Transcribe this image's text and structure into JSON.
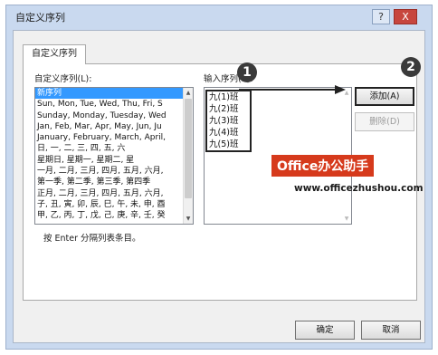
{
  "window": {
    "title": "自定义序列",
    "help_label": "?",
    "close_label": "X"
  },
  "tab": {
    "label": "自定义序列"
  },
  "left_list": {
    "label": "自定义序列(L):",
    "items": [
      "新序列",
      "Sun, Mon, Tue, Wed, Thu, Fri, S",
      "Sunday, Monday, Tuesday, Wed",
      "Jan, Feb, Mar, Apr, May, Jun, Ju",
      "January, February, March, April,",
      "日, 一, 二, 三, 四, 五, 六",
      "星期日, 星期一, 星期二, 星",
      "一月, 二月, 三月, 四月, 五月, 六月,",
      "第一季, 第二季, 第三季, 第四季",
      "正月, 二月, 三月, 四月, 五月, 六月,",
      "子, 丑, 寅, 卯, 辰, 巳, 午, 未, 申, 酉",
      "甲, 乙, 丙, 丁, 戊, 己, 庚, 辛, 壬, 癸"
    ],
    "selected_index": 0
  },
  "entries": {
    "label": "输入序列(E):",
    "items": [
      "九(1)班",
      "九(2)班",
      "九(3)班",
      "九(4)班",
      "九(5)班"
    ]
  },
  "buttons": {
    "add": "添加(A)",
    "delete": "删除(D)",
    "ok": "确定",
    "cancel": "取消"
  },
  "hint": "按 Enter 分隔列表条目。",
  "callouts": {
    "one": "1",
    "two": "2"
  },
  "watermark": {
    "brand": "Office办公助手",
    "url": "www.officezhushou.com"
  }
}
